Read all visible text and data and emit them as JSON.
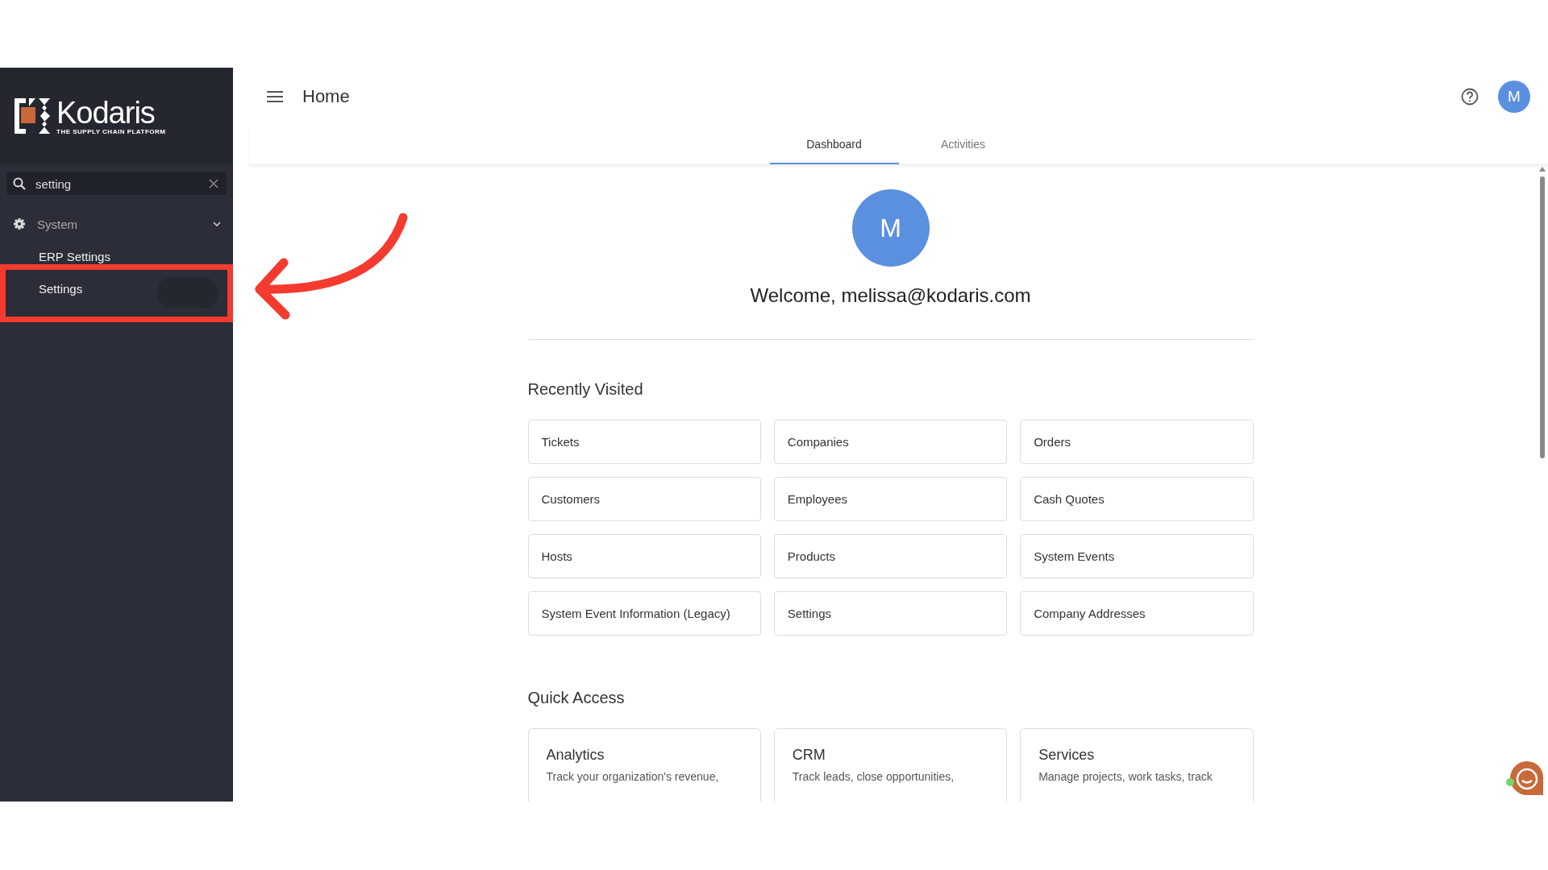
{
  "sidebar": {
    "logo": {
      "name": "Kodaris",
      "tagline": "THE SUPPLY CHAIN PLATFORM"
    },
    "search": {
      "value": "setting"
    },
    "menu": [
      {
        "label": "System",
        "expanded": true,
        "children": [
          {
            "label": "ERP Settings"
          },
          {
            "label": "Settings"
          }
        ]
      }
    ]
  },
  "header": {
    "title": "Home",
    "avatar": "M"
  },
  "tabs": [
    {
      "label": "Dashboard",
      "selected": true
    },
    {
      "label": "Activities",
      "selected": false
    }
  ],
  "profile": {
    "avatar": "M",
    "welcome": "Welcome, melissa@kodaris.com"
  },
  "recently_visited": {
    "title": "Recently Visited",
    "items": [
      "Tickets",
      "Companies",
      "Orders",
      "Customers",
      "Employees",
      "Cash Quotes",
      "Hosts",
      "Products",
      "System Events",
      "System Event Information (Legacy)",
      "Settings",
      "Company Addresses"
    ]
  },
  "quick_access": {
    "title": "Quick Access",
    "cards": [
      {
        "title": "Analytics",
        "description": "Track your organization's revenue,"
      },
      {
        "title": "CRM",
        "description": "Track leads, close opportunities,"
      },
      {
        "title": "Services",
        "description": "Manage projects, work tasks, track"
      }
    ]
  }
}
